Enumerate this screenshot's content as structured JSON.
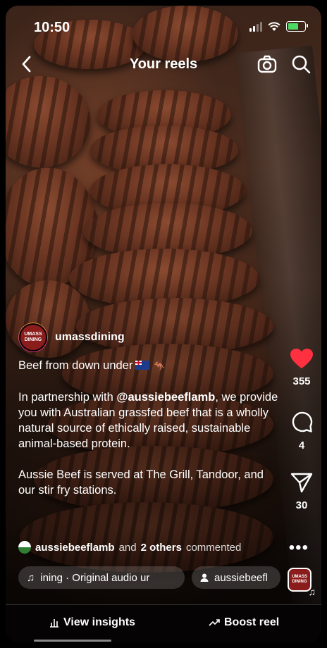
{
  "status_bar": {
    "time": "10:50"
  },
  "header": {
    "title": "Your reels"
  },
  "post": {
    "avatar_text": [
      "UMASS",
      "DINING"
    ],
    "username": "umassdining",
    "caption_line1": "Beef from down under",
    "caption_p2_prefix": "In partnership with ",
    "caption_p2_mention": "@aussiebeeflamb",
    "caption_p2_suffix": ", we provide you with Australian grassfed beef that is a wholly natural source of ethically raised, sustainable animal-based protein.",
    "caption_p3": "Aussie Beef is served at The Grill, Tandoor, and our stir fry stations.",
    "commented": {
      "user": "aussiebeeflamb",
      "middle": " and ",
      "others": "2 others",
      "suffix": " commented"
    },
    "audio_chip": "ining · Original audio   ur",
    "tag_chip": "aussiebeefl"
  },
  "actions": {
    "likes": "355",
    "comments": "4",
    "shares": "30",
    "like_color": "#ff3040"
  },
  "bottom": {
    "insights": "View insights",
    "boost": "Boost reel"
  }
}
